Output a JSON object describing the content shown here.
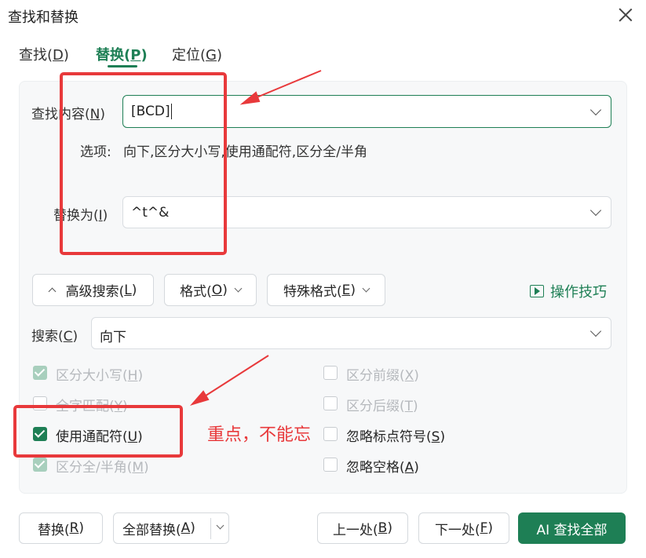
{
  "dialog": {
    "title": "查找和替换"
  },
  "tabs": [
    {
      "text": "查找(",
      "key": "D",
      "close": ")"
    },
    {
      "text": "替换(",
      "key": "P",
      "close": ")"
    },
    {
      "text": "定位(",
      "key": "G",
      "close": ")"
    }
  ],
  "find": {
    "label": "查找内容(",
    "key": "N",
    "close": ")",
    "value": "[BCD]"
  },
  "options": {
    "label": "选项:",
    "value": "向下,区分大小写,使用通配符,区分全/半角"
  },
  "replace": {
    "label": "替换为(",
    "key": "I",
    "close": ")",
    "value": "^t^&"
  },
  "advanced": {
    "text": "高级搜索(",
    "key": "L",
    "close": ")"
  },
  "format": {
    "text": "格式(",
    "key": "O",
    "close": ")"
  },
  "special": {
    "text": "特殊格式(",
    "key": "E",
    "close": ")"
  },
  "tips": {
    "label": "操作技巧"
  },
  "search": {
    "label": "搜索(",
    "key": "C",
    "close": ")",
    "value": "向下"
  },
  "checkboxes": [
    {
      "text": "区分大小写(",
      "key": "H",
      "close": ")"
    },
    {
      "text": "全字匹配(",
      "key": "Y",
      "close": ")"
    },
    {
      "text": "使用通配符(",
      "key": "U",
      "close": ")"
    },
    {
      "text": "区分全/半角(",
      "key": "M",
      "close": ")"
    },
    {
      "text": "区分前缀(",
      "key": "X",
      "close": ")"
    },
    {
      "text": "区分后缀(",
      "key": "T",
      "close": ")"
    },
    {
      "text": "忽略标点符号(",
      "key": "S",
      "close": ")"
    },
    {
      "text": "忽略空格(",
      "key": "A",
      "close": ")"
    }
  ],
  "buttons": {
    "replace": {
      "text": "替换(",
      "key": "R",
      "close": ")"
    },
    "replace_all": {
      "text": "全部替换(",
      "key": "A",
      "close": ")"
    },
    "prev": {
      "text": "上一处(",
      "key": "B",
      "close": ")"
    },
    "next": {
      "text": "下一处(",
      "key": "F",
      "close": ")"
    },
    "ai_find_all": "AI 查找全部"
  },
  "annotation": {
    "text": "重点，不能忘",
    "color": "#e8393b"
  },
  "colors": {
    "accent": "#1e7f55",
    "annotation_red": "#e8393b"
  }
}
